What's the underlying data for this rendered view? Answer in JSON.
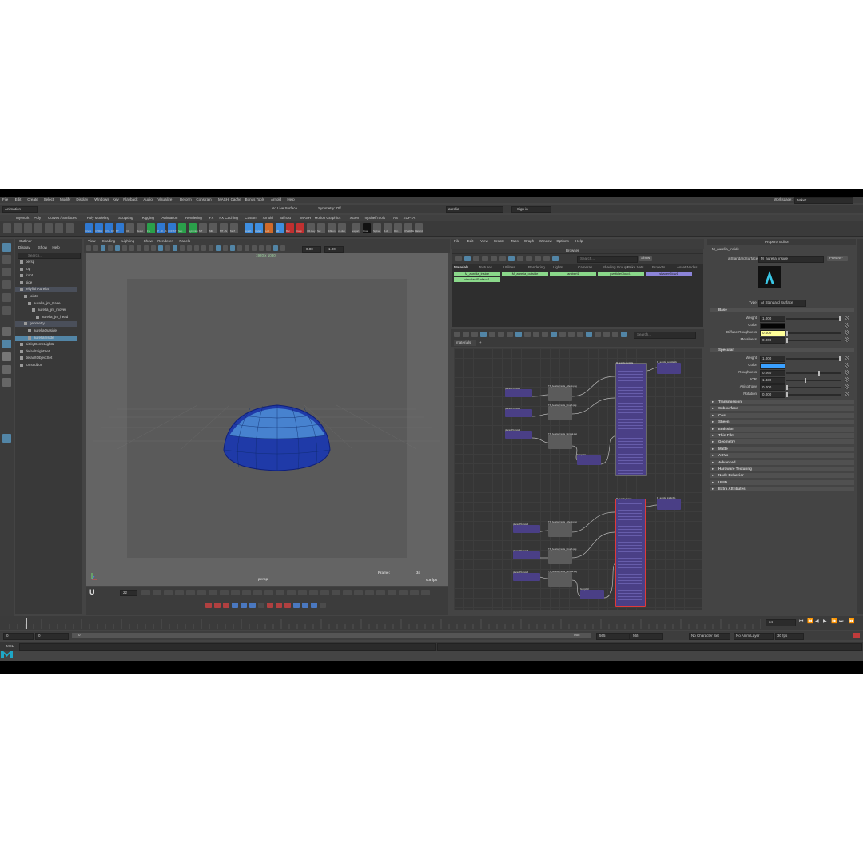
{
  "menubar": {
    "items": [
      "File",
      "Edit",
      "Create",
      "Select",
      "Modify",
      "Display",
      "Windows",
      "Key",
      "Playback",
      "Audio",
      "Visualize",
      "Deform",
      "Constrain",
      "MASH",
      "Cache",
      "Bonus Tools",
      "Arnold",
      "Help"
    ],
    "workspace_label": "Workspace:",
    "workspace_value": "Mike*"
  },
  "toolbar": {
    "mode": "Animation",
    "live_surface": "No Live Surface",
    "symmetry": "Symmetry: Off",
    "search_value": "aurelia",
    "signin": "Sign in"
  },
  "shelf_tabs": [
    "MyWork",
    "Poly",
    "Curves / Surfaces",
    "Poly Modeling",
    "Sculpting",
    "Rigging",
    "Animation",
    "Rendering",
    "FX",
    "FX Caching",
    "Custom",
    "Arnold",
    "Bifrost",
    "MASH",
    "Motion Graphics",
    "XGen",
    "myShelfTools",
    "AS",
    "ZUPTA"
  ],
  "shelf_labels": [
    "Orient",
    "CTRLz",
    "CV - CV",
    "BT",
    "CP",
    "Reset",
    "Fix",
    "P - R - S",
    "CONST",
    "Sep",
    "Symmtry",
    "MT",
    "MR",
    "MT - S",
    "MAT",
    "Graph",
    "CaGd",
    "Lod",
    "SB",
    "Bsc",
    "Carp",
    "CR-Key",
    "Sel",
    "Ribbon",
    "xs-dup",
    "export",
    "Crve",
    "Spline",
    "B-cl",
    "Dyn",
    "OVERLE",
    "Flatwrd"
  ],
  "outliner": {
    "title": "Outliner",
    "menu": [
      "Display",
      "Show",
      "Help"
    ],
    "search_placeholder": "Search...",
    "items": [
      {
        "label": "persp",
        "indent": 1,
        "state": "normal"
      },
      {
        "label": "top",
        "indent": 1,
        "state": "normal"
      },
      {
        "label": "front",
        "indent": 1,
        "state": "normal"
      },
      {
        "label": "side",
        "indent": 1,
        "state": "normal"
      },
      {
        "label": "jellyfishAurelia",
        "indent": 1,
        "state": "hl"
      },
      {
        "label": "joints",
        "indent": 2,
        "state": "normal"
      },
      {
        "label": "aurelia_jnt_Base",
        "indent": 3,
        "state": "normal"
      },
      {
        "label": "aurelia_jnt_mover",
        "indent": 4,
        "state": "normal"
      },
      {
        "label": "aurelia_jnt_head",
        "indent": 5,
        "state": "normal"
      },
      {
        "label": "geometry",
        "indent": 2,
        "state": "hl"
      },
      {
        "label": "aureliaOutside",
        "indent": 3,
        "state": "normal"
      },
      {
        "label": "aureliaInside",
        "indent": 3,
        "state": "sel"
      },
      {
        "label": "aiSkyDomeLight1",
        "indent": 1,
        "state": "normal"
      },
      {
        "label": "defaultLightSet",
        "indent": 1,
        "state": "normal"
      },
      {
        "label": "defaultObjectSet",
        "indent": 1,
        "state": "normal"
      },
      {
        "label": "tomo:dbox",
        "indent": 1,
        "state": "normal"
      }
    ]
  },
  "viewport": {
    "menu": [
      "View",
      "Shading",
      "Lighting",
      "Show",
      "Renderer",
      "Panels"
    ],
    "resolution": "1920 x 1080",
    "near_value": "0.00",
    "far_value": "1.00",
    "camera_name": "persp",
    "frame_label": "Frame:",
    "frame_value": "34",
    "fps": "0.5 fps",
    "bottom_field": "22"
  },
  "hypershade": {
    "menu": [
      "File",
      "Edit",
      "View",
      "Create",
      "Tabs",
      "Graph",
      "Window",
      "Options",
      "Help"
    ],
    "browser_title": "Browser",
    "show_button": "Show",
    "search_placeholder": "Search...",
    "tabs": [
      "Materials",
      "Textures",
      "Utilities",
      "Rendering",
      "Lights",
      "Cameras",
      "Shading Groups",
      "Bake Sets",
      "Projects",
      "Asset Nodes"
    ],
    "materials": [
      "M_aurelia_inside",
      "M_aurelia_outside",
      "lambert1",
      "particleCloud1",
      "shaderGlow1",
      "standardSurface1"
    ],
    "graph_tab": "materials",
    "graph_search": "Search..."
  },
  "graph_nodes": [
    {
      "label": "place2dTexture1"
    },
    {
      "label": "TX_Aurelia_Inside_Albedo.png"
    },
    {
      "label": "place2dTexture2"
    },
    {
      "label": "TX_Aurelia_Inside_Rough.png"
    },
    {
      "label": "place2dTexture3"
    },
    {
      "label": "TX_Aurelia_Inside_Normal.png"
    },
    {
      "label": "M_aurelia_outside"
    },
    {
      "label": "M_aurelia_outsideSG"
    },
    {
      "label": "bump2d1"
    },
    {
      "label": "place2dTexture4"
    },
    {
      "label": "TX_Aurelia_Inside_Albedo.png"
    },
    {
      "label": "place2dTexture5"
    },
    {
      "label": "TX_Aurelia_Inside_Rough.png"
    },
    {
      "label": "place2dTexture6"
    },
    {
      "label": "TX_Aurelia_Inside_Normal.png"
    },
    {
      "label": "M_aurelia_inside"
    },
    {
      "label": "M_aurelia_insideSG"
    },
    {
      "label": "bump2d2"
    }
  ],
  "property_editor": {
    "title": "Property Editor",
    "node_name": "M_aurelia_inside",
    "type_label": "aiStandardSurface:",
    "type_value": "M_aurelia_inside",
    "presets": "Presets*",
    "shader_type_label": "Type",
    "shader_type_value": "AI Standard Surface",
    "base_section": "Base",
    "base_attrs": [
      {
        "label": "Weight",
        "value": "1.000",
        "level": 1.0
      },
      {
        "label": "Color",
        "value": "",
        "level": null
      },
      {
        "label": "Diffuse Roughness",
        "value": "0.000",
        "level": 0.0
      },
      {
        "label": "Metalness",
        "value": "0.000",
        "level": 0.0
      }
    ],
    "specular_section": "Specular",
    "spec_attrs": [
      {
        "label": "Weight",
        "value": "1.000",
        "level": 1.0
      },
      {
        "label": "Color",
        "value": "",
        "level": null
      },
      {
        "label": "Roughness",
        "value": "0.060",
        "level": 0.6
      },
      {
        "label": "IOR",
        "value": "1.330",
        "level": 0.35
      },
      {
        "label": "Anisotropy",
        "value": "0.000",
        "level": 0.0
      },
      {
        "label": "Rotation",
        "value": "0.000",
        "level": 0.0
      }
    ],
    "collapsed_sections": [
      "Transmission",
      "Subsurface",
      "Coat",
      "Sheen",
      "Emission",
      "Thin Film",
      "Geometry",
      "Matte",
      "AOVs",
      "Advanced",
      "Hardware Texturing",
      "Node Behavior",
      "UUID",
      "Extra Attributes"
    ],
    "colors": {
      "base_color": "#050505",
      "spec_color": "#3aa0ff",
      "diffuse_roughness_field": "#ffff99"
    }
  },
  "timeline": {
    "current_frame": "34",
    "range_start": "0",
    "range_start2": "0",
    "range_inner_start": "0",
    "range_inner_end": "565",
    "range_end": "565",
    "range_end2": "565",
    "character_set": "No Character Set",
    "anim_layer": "No Anim Layer",
    "fps": "30 fps"
  },
  "command_line": {
    "lang": "MEL"
  },
  "colors": {
    "accent": "#5285a6",
    "material_green": "#8ad88a",
    "material_purple": "#8c84d9",
    "node_purple": "#4a3f86"
  }
}
